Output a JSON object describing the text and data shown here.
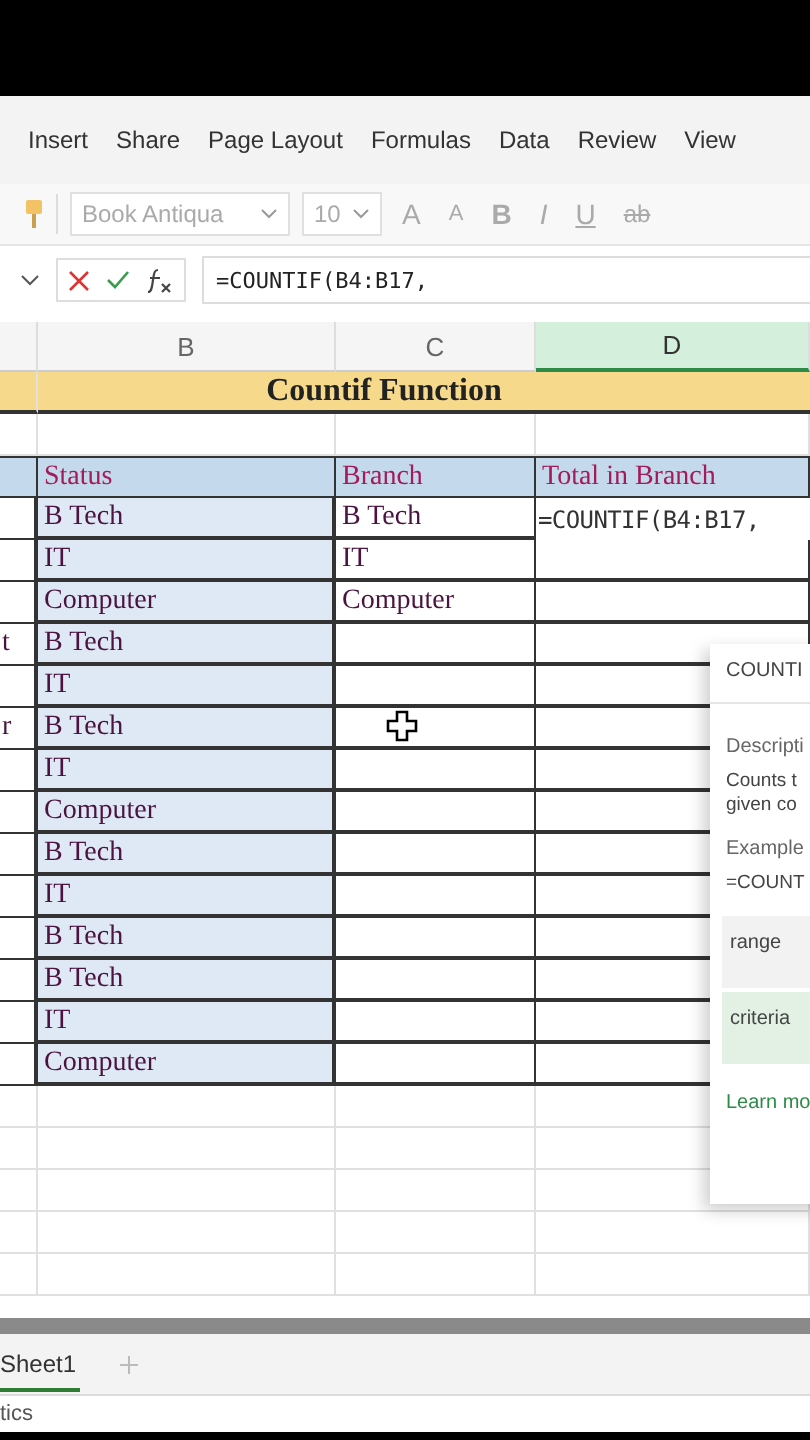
{
  "ribbon_tabs": [
    "Insert",
    "Share",
    "Page Layout",
    "Formulas",
    "Data",
    "Review",
    "View"
  ],
  "toolbar": {
    "font": "Book Antiqua",
    "size": "10",
    "format_buttons": [
      {
        "kind": "grow",
        "label": "A"
      },
      {
        "kind": "shrink",
        "label": "A"
      },
      {
        "kind": "bold",
        "label": "B"
      },
      {
        "kind": "italic",
        "label": "I"
      },
      {
        "kind": "underline",
        "label": "U"
      },
      {
        "kind": "strike",
        "label": "ab"
      }
    ]
  },
  "formula_bar": {
    "formula": "=COUNTIF(B4:B17,"
  },
  "columns": [
    {
      "label": "B",
      "selected": false
    },
    {
      "label": "C",
      "selected": false
    },
    {
      "label": "D",
      "selected": true
    }
  ],
  "sheet": {
    "title": "Countif Function",
    "headers": [
      "Status",
      "Branch",
      "Total in Branch"
    ],
    "rows": [
      {
        "a": "",
        "b": "B Tech",
        "c": "B Tech",
        "d": "=COUNTIF(B4:B17,"
      },
      {
        "a": "",
        "b": "IT",
        "c": "IT",
        "d": ""
      },
      {
        "a": "",
        "b": "Computer",
        "c": "Computer",
        "d": ""
      },
      {
        "a": "t",
        "b": "B Tech",
        "c": "",
        "d": ""
      },
      {
        "a": "",
        "b": "IT",
        "c": "",
        "d": ""
      },
      {
        "a": "r",
        "b": "B Tech",
        "c": "",
        "d": ""
      },
      {
        "a": "",
        "b": "IT",
        "c": "",
        "d": ""
      },
      {
        "a": "",
        "b": "Computer",
        "c": "",
        "d": ""
      },
      {
        "a": "",
        "b": "B Tech",
        "c": "",
        "d": ""
      },
      {
        "a": "",
        "b": "IT",
        "c": "",
        "d": ""
      },
      {
        "a": "",
        "b": "B Tech",
        "c": "",
        "d": ""
      },
      {
        "a": "",
        "b": "B Tech",
        "c": "",
        "d": ""
      },
      {
        "a": "",
        "b": "IT",
        "c": "",
        "d": ""
      },
      {
        "a": "",
        "b": "Computer",
        "c": "",
        "d": ""
      }
    ]
  },
  "function_panel": {
    "title": "COUNTI",
    "description_label": "Descripti",
    "description": [
      "Counts t",
      "given co"
    ],
    "example_label": "Example",
    "example": "=COUNT",
    "arguments": [
      {
        "name": "range",
        "selected": false
      },
      {
        "name": "criteria",
        "selected": true
      }
    ],
    "link": "Learn mo"
  },
  "sheet_tabs": [
    {
      "label": "Sheet1",
      "selected": true
    }
  ],
  "status_bar": "tics"
}
